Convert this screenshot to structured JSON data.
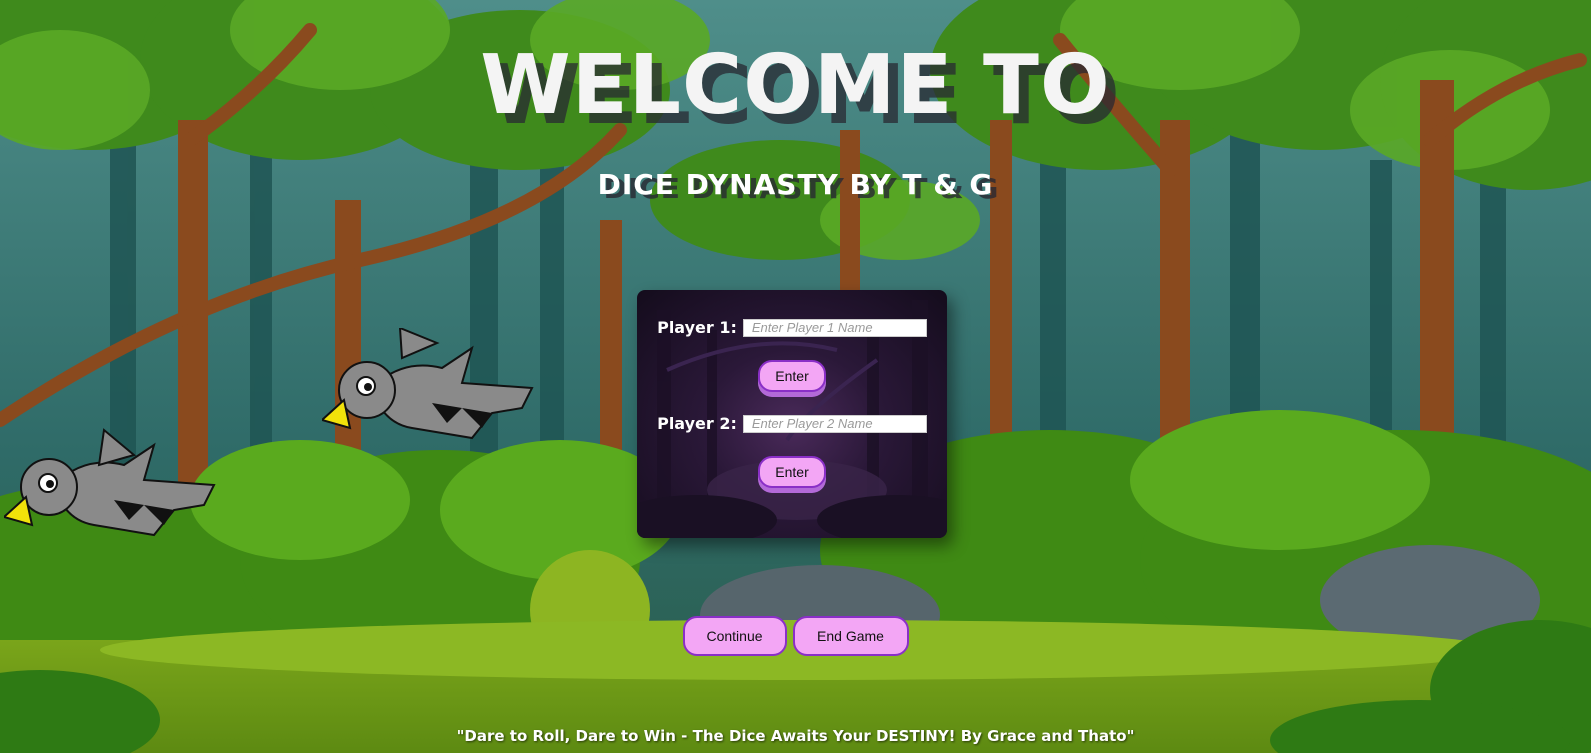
{
  "header": {
    "title": "WELCOME TO",
    "subtitle": "DICE DYNASTY BY T & G"
  },
  "player_form": {
    "player1": {
      "label": "Player 1:",
      "placeholder": "Enter Player 1 Name",
      "value": "",
      "button_label": "Enter"
    },
    "player2": {
      "label": "Player 2:",
      "placeholder": "Enter Player 2 Name",
      "value": "",
      "button_label": "Enter"
    }
  },
  "actions": {
    "continue_label": "Continue",
    "end_game_label": "End Game"
  },
  "footer": {
    "tagline": "\"Dare to Roll, Dare to Win - The Dice Awaits Your DESTINY! By Grace and Thato\""
  },
  "colors": {
    "button_fill": "#f3a6f5",
    "button_border": "#8a2fc7",
    "title_text": "#f4f4f4"
  },
  "icons": {
    "characters": [
      "crow-sprite",
      "crow-sprite"
    ]
  }
}
